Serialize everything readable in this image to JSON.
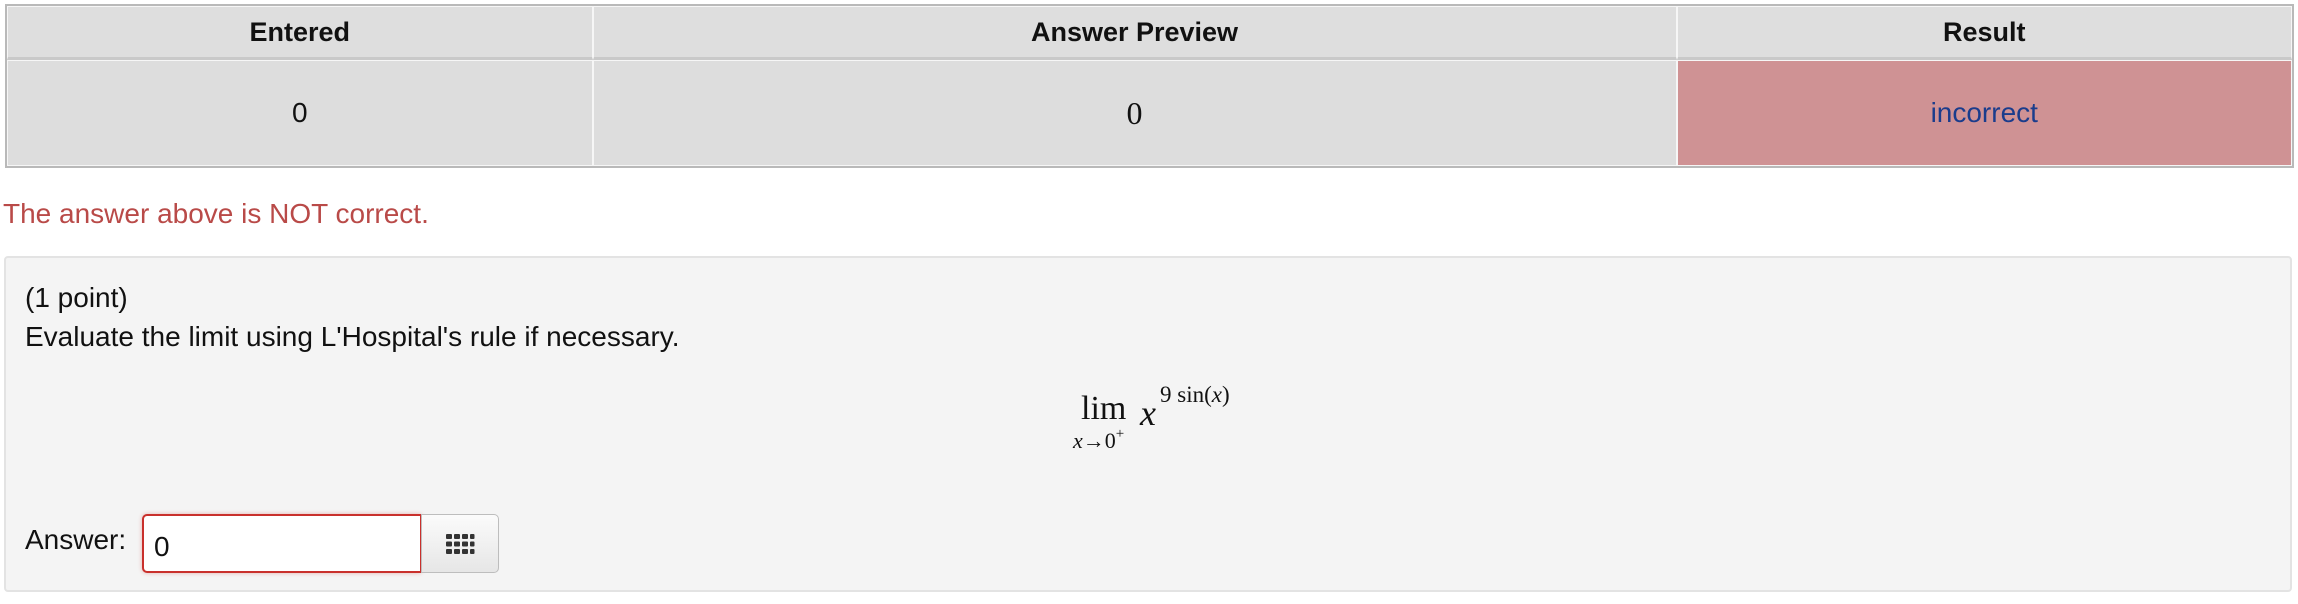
{
  "results_table": {
    "headers": {
      "entered": "Entered",
      "answer_preview": "Answer Preview",
      "result": "Result"
    },
    "row": {
      "entered": "0",
      "answer_preview": "0",
      "result": "incorrect"
    }
  },
  "status_message": "The answer above is NOT correct.",
  "problem": {
    "points": "(1 point)",
    "prompt": "Evaluate the limit using L'Hospital's rule if necessary.",
    "math": {
      "lim": "lim",
      "variable": "x",
      "arrow": "→",
      "approach_value": "0",
      "approach_side": "+",
      "base": "x",
      "exponent_coefficient": "9",
      "exponent_function": "sin",
      "exponent_argument": "x"
    },
    "answer_label": "Answer:",
    "answer_value": "0"
  },
  "colors": {
    "incorrect_cell": "#cf9294",
    "incorrect_text": "#1a3c8c",
    "status_text": "#b94a48",
    "input_error_border": "#c9302c"
  },
  "icons": {
    "keypad": "keypad-grid-icon"
  }
}
